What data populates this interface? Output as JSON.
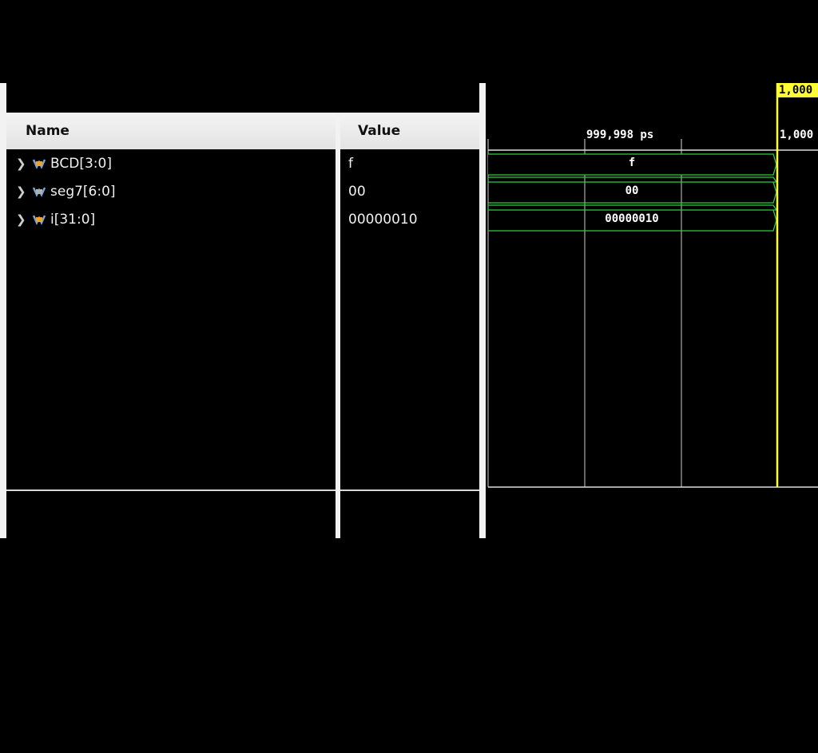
{
  "columns": {
    "name_header": "Name",
    "value_header": "Value"
  },
  "signals": [
    {
      "name": "BCD[3:0]",
      "value": "f",
      "icon": "bus-icon-orange"
    },
    {
      "name": "seg7[6:0]",
      "value": "00",
      "icon": "bus-icon-gray"
    },
    {
      "name": "i[31:0]",
      "value": "00000010",
      "icon": "bus-icon-orange"
    }
  ],
  "waveform": {
    "cursor_time_label": "1,000",
    "timeline_label_left": "999,998 ps",
    "timeline_label_right": "1,000",
    "wave_values": [
      "f",
      "00",
      "00000010"
    ],
    "colors": {
      "wave": "#2ecc40",
      "cursor": "#ffff33",
      "cursor_label_bg": "#ffff33"
    }
  }
}
